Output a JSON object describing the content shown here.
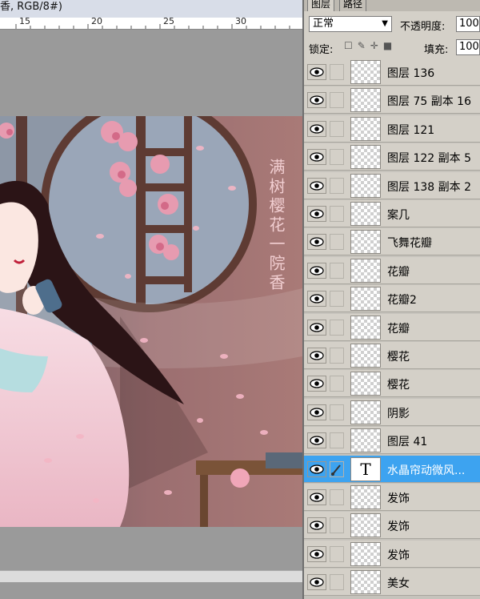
{
  "window": {
    "title_fragment": "香, RGB/8#)"
  },
  "ruler": {
    "labels": [
      "15",
      "20",
      "25",
      "30"
    ]
  },
  "artwork": {
    "poem": "满树樱花一院香"
  },
  "panel": {
    "tabs": [
      "图层",
      "路径"
    ],
    "blend_mode": "正常",
    "opacity_label": "不透明度:",
    "opacity_value": "100",
    "lock_label": "锁定:",
    "fill_label": "填充:",
    "fill_value": "100"
  },
  "layers": [
    {
      "name": "图层 136",
      "selected": false
    },
    {
      "name": "图层 75 副本 16",
      "selected": false
    },
    {
      "name": "图层 121",
      "selected": false
    },
    {
      "name": "图层 122 副本 5",
      "selected": false
    },
    {
      "name": "图层 138 副本 2",
      "selected": false
    },
    {
      "name": "案几",
      "selected": false
    },
    {
      "name": "飞舞花瓣",
      "selected": false
    },
    {
      "name": "花瓣",
      "selected": false
    },
    {
      "name": "花瓣2",
      "selected": false
    },
    {
      "name": "花瓣",
      "selected": false
    },
    {
      "name": "樱花",
      "selected": false
    },
    {
      "name": "樱花",
      "selected": false
    },
    {
      "name": "阴影",
      "selected": false
    },
    {
      "name": "图层 41",
      "selected": false
    },
    {
      "name": "水晶帘动微风...",
      "selected": true,
      "type": "text",
      "thumb_glyph": "T"
    },
    {
      "name": "发饰",
      "selected": false
    },
    {
      "name": "发饰",
      "selected": false
    },
    {
      "name": "发饰",
      "selected": false
    },
    {
      "name": "美女",
      "selected": false
    }
  ],
  "colors": {
    "selection": "#3da3f0",
    "panel_bg": "#d4d0c8",
    "poem_text": "#f2cfd2"
  },
  "icons": [
    "eye-icon",
    "brush-link-icon",
    "lock-icon",
    "move-icon",
    "dropdown-arrow-icon"
  ]
}
